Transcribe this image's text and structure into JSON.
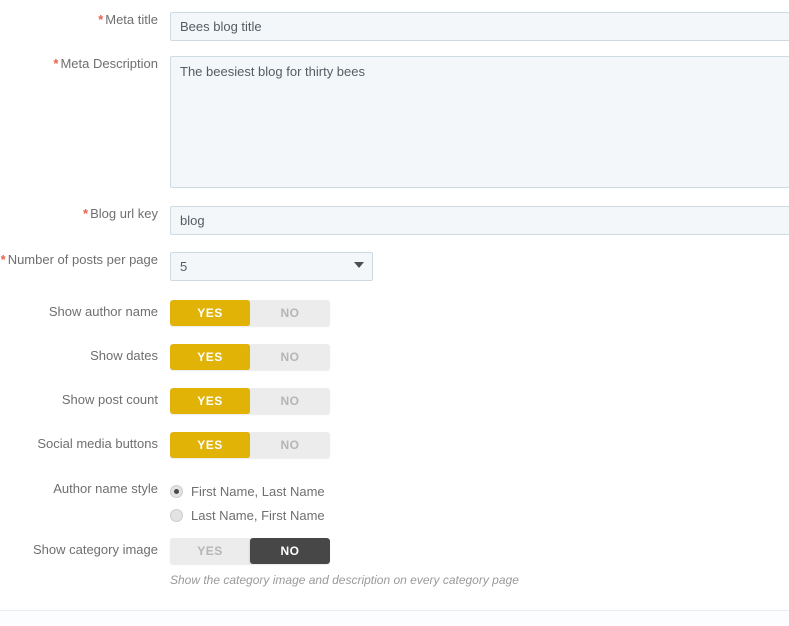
{
  "form": {
    "fields": [
      {
        "id": "meta-title",
        "label": "Meta title",
        "required": true,
        "type": "text",
        "value": "Bees blog title",
        "placeholder": ""
      },
      {
        "id": "meta-description",
        "label": "Meta Description",
        "required": true,
        "type": "textarea",
        "value": "The beesiest blog for thirty bees",
        "placeholder": ""
      },
      {
        "id": "blog-url-key",
        "label": "Blog url key",
        "required": true,
        "type": "text",
        "value": "blog",
        "placeholder": ""
      },
      {
        "id": "posts-per-page",
        "label": "Number of posts per page",
        "required": true,
        "type": "select",
        "value": "5",
        "caret_icon": "chevron-down-icon"
      },
      {
        "id": "show-author-name",
        "label": "Show author name",
        "required": false,
        "type": "toggle",
        "yes_label": "YES",
        "no_label": "NO",
        "value": "YES"
      },
      {
        "id": "show-dates",
        "label": "Show dates",
        "required": false,
        "type": "toggle",
        "yes_label": "YES",
        "no_label": "NO",
        "value": "YES"
      },
      {
        "id": "show-post-count",
        "label": "Show post count",
        "required": false,
        "type": "toggle",
        "yes_label": "YES",
        "no_label": "NO",
        "value": "YES"
      },
      {
        "id": "social-media-buttons",
        "label": "Social media buttons",
        "required": false,
        "type": "toggle",
        "yes_label": "YES",
        "no_label": "NO",
        "value": "YES"
      },
      {
        "id": "author-name-style",
        "label": "Author name style",
        "required": false,
        "type": "radio",
        "options": [
          {
            "label": "First Name, Last Name",
            "checked": true
          },
          {
            "label": "Last Name, First Name",
            "checked": false
          }
        ]
      },
      {
        "id": "show-category-image",
        "label": "Show category image",
        "required": false,
        "type": "toggle",
        "yes_label": "YES",
        "no_label": "NO",
        "value": "NO",
        "hint": "Show the category image and description on every category page"
      }
    ],
    "required_marker": "*"
  },
  "colors": {
    "toggle_on_yes": "#e0b306",
    "toggle_on_no": "#474747",
    "toggle_off_bg": "#ececec",
    "input_bg": "#f3f7f9",
    "input_border": "#cfdbe3",
    "label_text": "#6f6f6f",
    "required_asterisk": "#e8604c",
    "hint_text": "#9a9a9a"
  }
}
